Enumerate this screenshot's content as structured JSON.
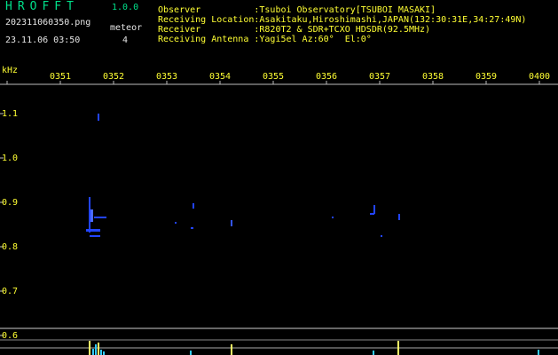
{
  "header": {
    "app_title": "HROFFT",
    "app_version": "1.0.0",
    "filename": "202311060350.png",
    "meteor_label": "meteor",
    "datetime": "23.11.06 03:50",
    "meteor_count": "4"
  },
  "info_lines": [
    "Observer          :Tsuboi Observatory[TSUBOI MASAKI]",
    "Receiving Location:Asakitaku,Hiroshimashi,JAPAN(132:30:31E,34:27:49N)",
    "Receiver          :R820T2 & SDR+TCXO HDSDR(92.5MHz)",
    "Receiving Antenna :Yagi5el Az:60°  El:0°"
  ],
  "axis": {
    "y_unit": "kHz",
    "time_ticks": [
      "0351",
      "0352",
      "0353",
      "0354",
      "0355",
      "0356",
      "0357",
      "0358",
      "0359",
      "0400"
    ],
    "y_ticks": [
      "1.1",
      "1.0",
      "0.9",
      "0.8",
      "0.7",
      "0.6"
    ]
  },
  "colors": {
    "title": "#00e08a",
    "labels": "#ffff33",
    "text": "#e6e6e6",
    "grid": "#2a3aff",
    "signal": "#2244ff",
    "bars": "#33ccff"
  }
}
